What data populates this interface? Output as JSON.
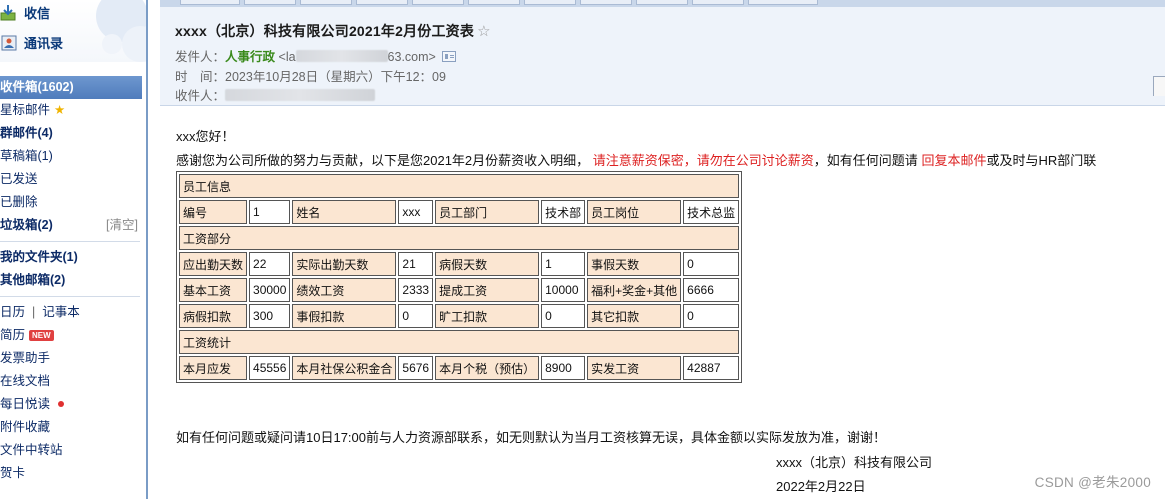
{
  "sidebar": {
    "top_links": [
      {
        "label": "收信",
        "icon": "inbox-download-icon"
      },
      {
        "label": "通讯录",
        "icon": "address-book-icon"
      }
    ],
    "folders": [
      {
        "label": "收件箱(1602)",
        "style": "active"
      },
      {
        "label": "星标邮件",
        "style": "normal"
      },
      {
        "label": "群邮件(4)",
        "style": "bold"
      },
      {
        "label": "草稿箱(1)",
        "style": "normal"
      },
      {
        "label": "已发送",
        "style": "normal"
      },
      {
        "label": "已删除",
        "style": "normal"
      },
      {
        "label": "垃圾箱(2)",
        "style": "bold",
        "extra": "[清空]"
      }
    ],
    "my_folders": "我的文件夹(1)",
    "other_mailboxes": "其他邮箱(2)",
    "tools": {
      "calendar": "日历",
      "notes": "记事本",
      "resume": "简历",
      "new_badge": "NEW",
      "invoice_helper": "发票助手",
      "online_docs": "在线文档",
      "daily_reading": "每日悦读",
      "attachments": "附件收藏",
      "file_transfer": "文件中转站",
      "greeting_card": "贺卡"
    }
  },
  "email": {
    "subject": "xxxx（北京）科技有限公司2021年2月份工资表",
    "star_symbol": "☆",
    "sender_label": "发件人：",
    "sender_name": "人事行政",
    "sender_addr_start": "<la",
    "sender_addr_end": "63.com>",
    "time_label": "时　间：",
    "time_value": "2023年10月28日（星期六）下午12：09",
    "recipient_label": "收件人："
  },
  "body": {
    "greeting": "xxx您好！",
    "intro_1": "感谢您为公司所做的努力与贡献，以下是您2021年2月份薪资收入明细，",
    "intro_red_1": "请注意薪资保密，请勿在公司讨论薪资",
    "intro_2": "，如有任何问题请",
    "intro_red_2": "回复本邮件",
    "intro_3": "或及时与HR部门联",
    "table": {
      "section_employee": "员工信息",
      "emp_id_label": "编号",
      "emp_id": "1",
      "name_label": "姓名",
      "name": "xxx",
      "dept_label": "员工部门",
      "dept": "技术部",
      "position_label": "员工岗位",
      "position": "技术总监",
      "section_salary": "工资部分",
      "days_due_label": "应出勤天数",
      "days_due": "22",
      "days_actual_label": "实际出勤天数",
      "days_actual": "21",
      "sick_label": "病假天数",
      "sick": "1",
      "personal_label": "事假天数",
      "personal": "0",
      "base_label": "基本工资",
      "base": "30000",
      "perf_label": "绩效工资",
      "perf": "2333",
      "commission_label": "提成工资",
      "commission": "10000",
      "bonus_label": "福利+奖金+其他",
      "bonus": "6666",
      "sick_ded_label": "病假扣款",
      "sick_ded": "300",
      "personal_ded_label": "事假扣款",
      "personal_ded": "0",
      "absent_ded_label": "旷工扣款",
      "absent_ded": "0",
      "other_ded_label": "其它扣款",
      "other_ded": "0",
      "section_stats": "工资统计",
      "gross_label": "本月应发",
      "gross": "45556",
      "insurance_label": "本月社保公积金合",
      "insurance": "5676",
      "tax_label": "本月个税（预估）",
      "tax": "8900",
      "net_label": "实发工资",
      "net": "42887"
    },
    "closing": "如有任何问题或疑问请10日17:00前与人力资源部联系，如无则默认为当月工资核算无误，具体金额以实际发放为准，谢谢！",
    "company": "xxxx（北京）科技有限公司",
    "date": "2022年2月22日"
  },
  "watermark": "CSDN @老朱2000"
}
